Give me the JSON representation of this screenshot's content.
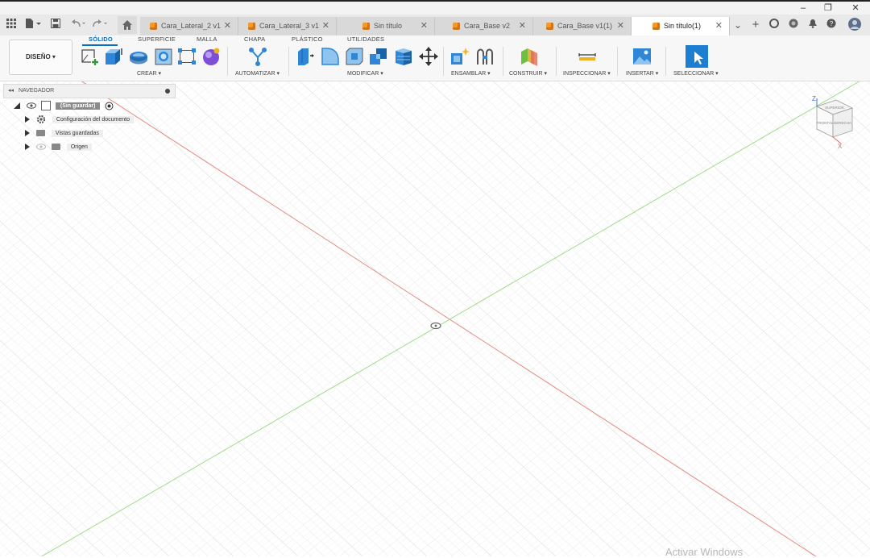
{
  "window": {
    "minimize": "–",
    "restore": "❐",
    "close": "✕"
  },
  "quick_access": {
    "grid_icon": "grid-icon",
    "file_icon": "file-icon",
    "save_icon": "save-icon",
    "undo_icon": "undo-icon",
    "redo_icon": "redo-icon",
    "home_icon": "home-icon"
  },
  "tabs": [
    {
      "label": "Cara_Lateral_2 v1",
      "active": false
    },
    {
      "label": "Cara_Lateral_3 v1",
      "active": false
    },
    {
      "label": "Sin título",
      "active": false
    },
    {
      "label": "Cara_Base v2",
      "active": false
    },
    {
      "label": "Cara_Base v1(1)",
      "active": false
    },
    {
      "label": "Sin título(1)",
      "active": true
    }
  ],
  "tab_close": "✕",
  "right_controls": {
    "overflow": "⌄",
    "add": "+"
  },
  "toolbar": {
    "workspace": "DISEÑO ▾",
    "menu_tabs": [
      "SÓLIDO",
      "SUPERFICIE",
      "MALLA",
      "CHAPA",
      "PLÁSTICO",
      "UTILIDADES"
    ],
    "groups": [
      "CREAR ▾",
      "AUTOMATIZAR ▾",
      "MODIFICAR ▾",
      "ENSAMBLAR ▾",
      "CONSTRUIR ▾",
      "INSPECCIONAR ▾",
      "INSERTAR ▾",
      "SELECCIONAR ▾"
    ]
  },
  "browser": {
    "title": "NAVEGADOR",
    "root": "(Sin guardar)",
    "items": [
      {
        "label": "Configuración del documento"
      },
      {
        "label": "Vistas guardadas"
      },
      {
        "label": "Origen"
      }
    ]
  },
  "viewcube": {
    "top": "SUPERIOR",
    "front": "FRONTAL",
    "right": "DERECHA",
    "axis_z": "Z",
    "axis_x": "X"
  },
  "colors": {
    "accent": "#0a6fbf",
    "x_axis": "#e48b80",
    "y_axis": "#9fdc8a",
    "grid": "#e2e2e2"
  },
  "watermark": "Activar Windows"
}
